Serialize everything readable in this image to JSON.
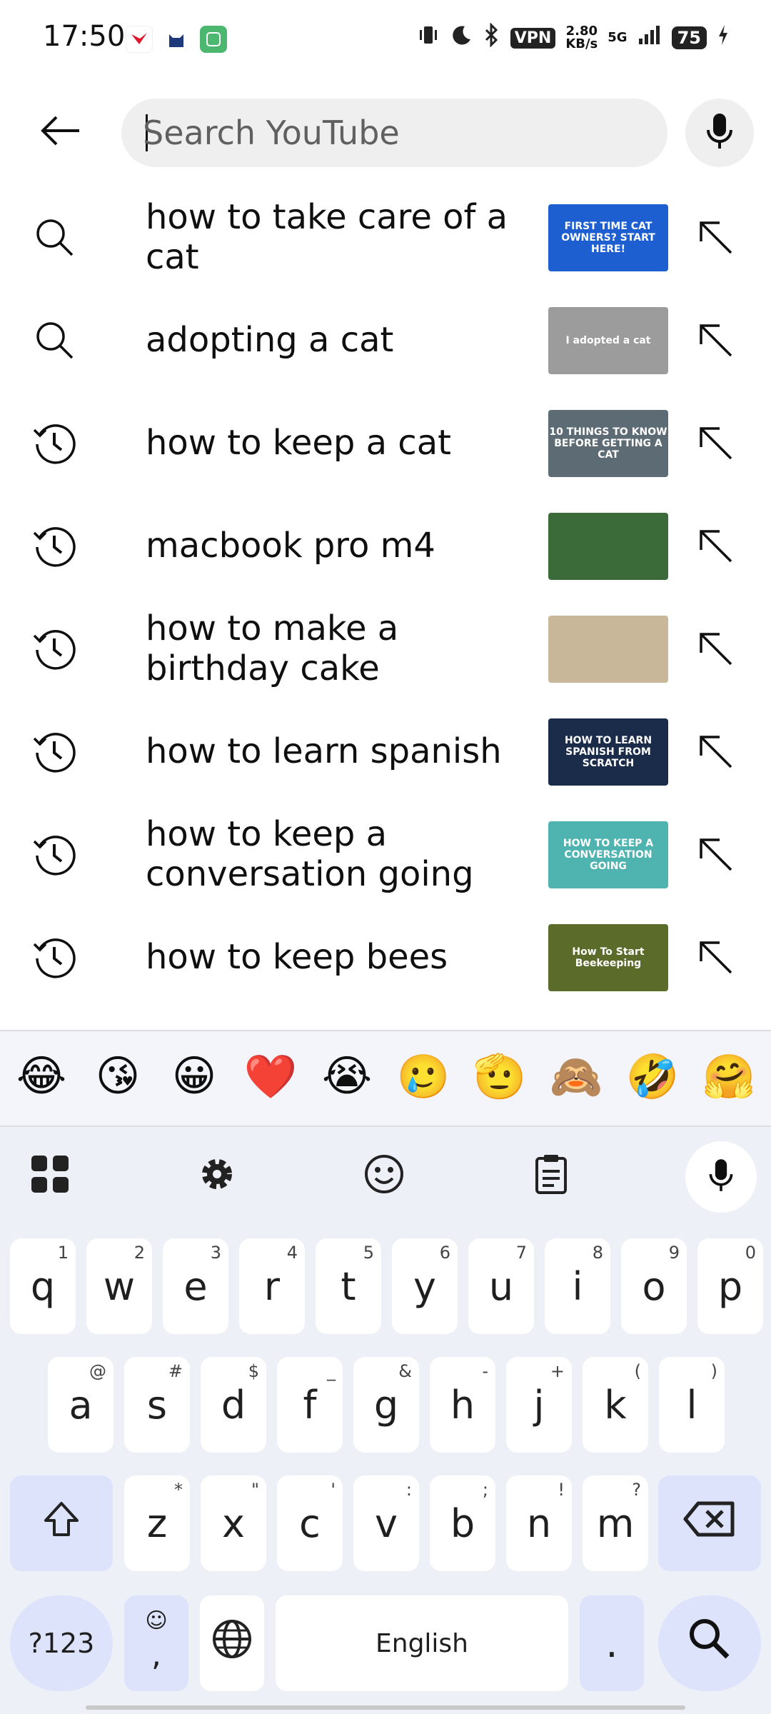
{
  "status_bar": {
    "time": "17:50",
    "vpn": "VPN",
    "net_speed_value": "2.80",
    "net_speed_unit": "KB/s",
    "network": "5G",
    "battery": "75"
  },
  "search": {
    "placeholder": "Search YouTube",
    "value": ""
  },
  "suggestions": [
    {
      "type": "search",
      "text": "how to take care of a cat",
      "thumb_text": "FIRST TIME CAT OWNERS? START HERE!",
      "thumb_color": "#1d5fd1"
    },
    {
      "type": "search",
      "text": "adopting a cat",
      "thumb_text": "I adopted a cat",
      "thumb_color": "#9c9c9c"
    },
    {
      "type": "history",
      "text": "how to keep a cat",
      "thumb_text": "10 THINGS TO KNOW BEFORE GETTING A CAT",
      "thumb_color": "#5d6b74"
    },
    {
      "type": "history",
      "text": "macbook pro m4",
      "thumb_text": "",
      "thumb_color": "#3c6b3a"
    },
    {
      "type": "history",
      "text": "how to make a birthday cake",
      "thumb_text": "",
      "thumb_color": "#c9b79a"
    },
    {
      "type": "history",
      "text": "how to learn spanish",
      "thumb_text": "HOW TO LEARN SPANISH FROM SCRATCH",
      "thumb_color": "#1b2b4a"
    },
    {
      "type": "history",
      "text": "how to keep a conversation going",
      "thumb_text": "HOW TO KEEP A CONVERSATION GOING",
      "thumb_color": "#4fb3b0"
    },
    {
      "type": "history",
      "text": "how to keep bees",
      "thumb_text": "How To Start Beekeeping",
      "thumb_color": "#5b6b2a"
    }
  ],
  "keyboard": {
    "emojis": [
      "😂",
      "😘",
      "😀",
      "❤️",
      "😭",
      "🥲",
      "🫡",
      "🙈",
      "🤣",
      "🤗"
    ],
    "row1": [
      {
        "key": "q",
        "hint": "1"
      },
      {
        "key": "w",
        "hint": "2"
      },
      {
        "key": "e",
        "hint": "3"
      },
      {
        "key": "r",
        "hint": "4"
      },
      {
        "key": "t",
        "hint": "5"
      },
      {
        "key": "y",
        "hint": "6"
      },
      {
        "key": "u",
        "hint": "7"
      },
      {
        "key": "i",
        "hint": "8"
      },
      {
        "key": "o",
        "hint": "9"
      },
      {
        "key": "p",
        "hint": "0"
      }
    ],
    "row2": [
      {
        "key": "a",
        "hint": "@"
      },
      {
        "key": "s",
        "hint": "#"
      },
      {
        "key": "d",
        "hint": "$"
      },
      {
        "key": "f",
        "hint": "_"
      },
      {
        "key": "g",
        "hint": "&"
      },
      {
        "key": "h",
        "hint": "-"
      },
      {
        "key": "j",
        "hint": "+"
      },
      {
        "key": "k",
        "hint": "("
      },
      {
        "key": "l",
        "hint": ")"
      }
    ],
    "row3": [
      {
        "key": "z",
        "hint": "*"
      },
      {
        "key": "x",
        "hint": "\""
      },
      {
        "key": "c",
        "hint": "'"
      },
      {
        "key": "v",
        "hint": ":"
      },
      {
        "key": "b",
        "hint": ";"
      },
      {
        "key": "n",
        "hint": "!"
      },
      {
        "key": "m",
        "hint": "?"
      }
    ],
    "symbols_label": "?123",
    "comma_label": ",",
    "space_label": "English",
    "period_label": "."
  }
}
